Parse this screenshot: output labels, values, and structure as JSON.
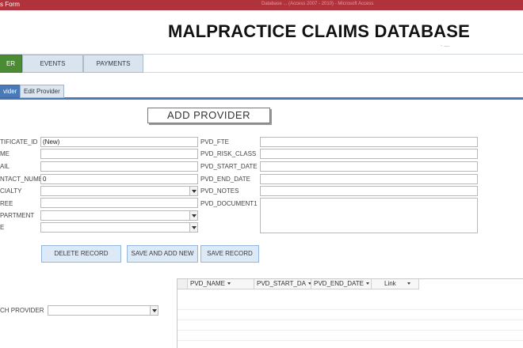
{
  "window": {
    "title": "s Form",
    "faint_text": "Database ... (Access 2007 - 2010) - Microsoft Access"
  },
  "header": {
    "title": "MALPRACTICE CLAIMS DATABASE",
    "small_text": "- —"
  },
  "main_nav": {
    "tabs": [
      {
        "label": "ER",
        "active": true
      },
      {
        "label": "EVENTS",
        "active": false
      },
      {
        "label": "PAYMENTS",
        "active": false
      }
    ]
  },
  "sub_tabs": [
    {
      "label": "vider",
      "active": true
    },
    {
      "label": "Edit Provider",
      "active": false
    }
  ],
  "form": {
    "add_button": "ADD PROVIDER",
    "left_fields": [
      {
        "label": "TIFICATE_ID",
        "value": "(New)",
        "combo": false
      },
      {
        "label": "ME",
        "value": "",
        "combo": false
      },
      {
        "label": "AIL",
        "value": "",
        "combo": false
      },
      {
        "label": "NTACT_NUME",
        "value": "0",
        "combo": false
      },
      {
        "label": "CIALTY",
        "value": "",
        "combo": true
      },
      {
        "label": "REE",
        "value": "",
        "combo": false
      },
      {
        "label": "PARTMENT",
        "value": "",
        "combo": true
      },
      {
        "label": "E",
        "value": "",
        "combo": true
      }
    ],
    "right_fields": [
      {
        "label": "PVD_FTE",
        "value": ""
      },
      {
        "label": "PVD_RISK_CLASS",
        "value": ""
      },
      {
        "label": "PVD_START_DATE",
        "value": ""
      },
      {
        "label": "PVD_END_DATE",
        "value": ""
      },
      {
        "label": "PVD_NOTES",
        "value": ""
      },
      {
        "label": "PVD_DOCUMENT1",
        "value": ""
      }
    ],
    "buttons": {
      "delete": "DELETE RECORD",
      "save_add": "SAVE AND ADD NEW",
      "save": "SAVE RECORD"
    }
  },
  "search": {
    "label": "CH PROVIDER",
    "value": ""
  },
  "grid": {
    "columns": [
      "PVD_NAME",
      "PVD_START_DA",
      "PVD_END_DATE",
      "Link"
    ]
  }
}
